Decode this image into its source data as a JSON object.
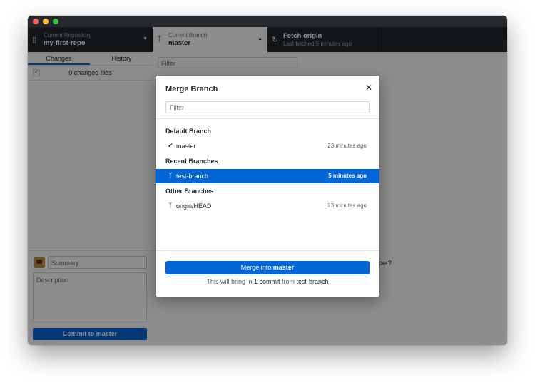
{
  "toolbar": {
    "repo_label": "Current Repository",
    "repo_name": "my-first-repo",
    "branch_label": "Current Branch",
    "branch_name": "master",
    "fetch_title": "Fetch origin",
    "fetch_subtitle": "Last fetched 5 minutes ago"
  },
  "sidebar": {
    "tabs": [
      {
        "label": "Changes"
      },
      {
        "label": "History"
      }
    ],
    "changed_files": "0 changed files",
    "summary_placeholder": "Summary",
    "description_placeholder": "Description",
    "commit_button": "Commit to master"
  },
  "branch_panel": {
    "filter_placeholder": "Filter"
  },
  "main": {
    "partial_text": "nder?"
  },
  "modal": {
    "title": "Merge Branch",
    "filter_placeholder": "Filter",
    "groups": [
      {
        "header": "Default Branch",
        "branches": [
          {
            "name": "master",
            "time": "23 minutes ago",
            "icon": "check-icon"
          }
        ]
      },
      {
        "header": "Recent Branches",
        "branches": [
          {
            "name": "test-branch",
            "time": "5 minutes ago",
            "icon": "branch-icon",
            "selected": true
          }
        ]
      },
      {
        "header": "Other Branches",
        "branches": [
          {
            "name": "origin/HEAD",
            "time": "23 minutes ago",
            "icon": "branch-icon"
          }
        ]
      }
    ],
    "merge_button_prefix": "Merge into",
    "merge_button_target": "master",
    "info_prefix": "This will bring in",
    "info_count": "1 commit",
    "info_middle": "from",
    "info_branch": "test-branch"
  },
  "colors": {
    "accent": "#0366d6",
    "toolbar_bg": "#24292e",
    "overlay": "rgba(0,0,0,0.45)"
  }
}
